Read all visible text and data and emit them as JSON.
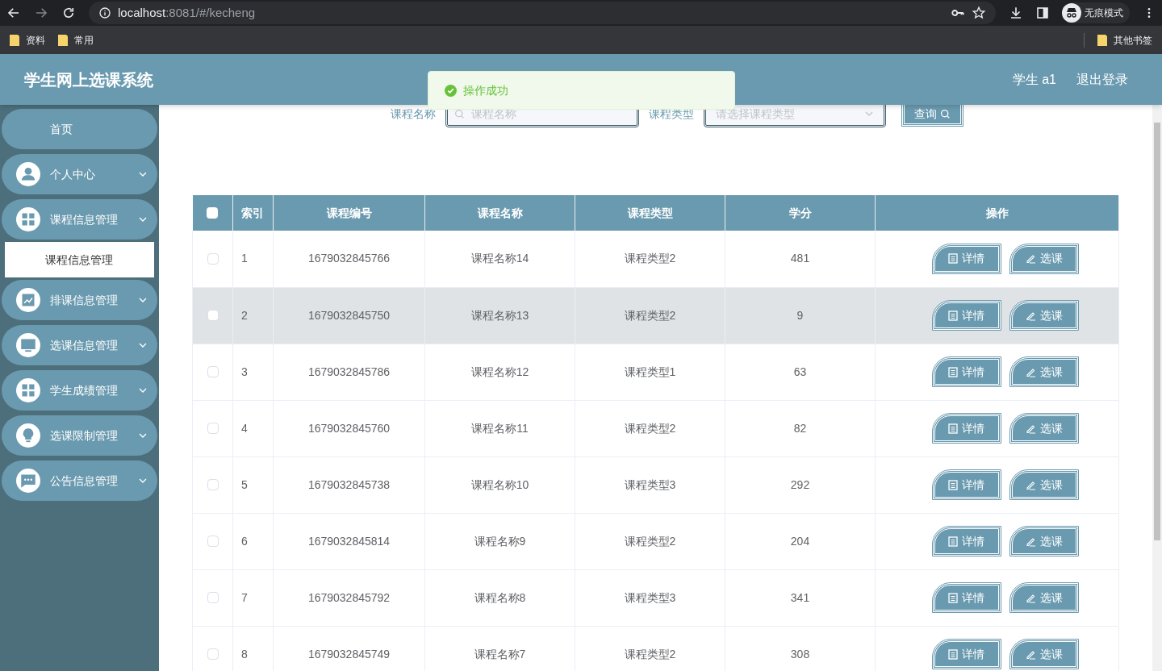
{
  "browser": {
    "url_host": "localhost",
    "url_rest": ":8081/#/kecheng",
    "bookmarks": [
      "资料",
      "常用"
    ],
    "other_bookmarks": "其他书签",
    "profile": "无痕模式"
  },
  "header": {
    "title": "学生网上选课系统",
    "user": "学生 a1",
    "logout": "退出登录"
  },
  "toast": {
    "message": "操作成功"
  },
  "sidebar": {
    "items": [
      {
        "label": "首页",
        "kind": "link"
      },
      {
        "label": "个人中心",
        "kind": "menu"
      },
      {
        "label": "课程信息管理",
        "kind": "menu",
        "children": [
          {
            "label": "课程信息管理",
            "selected": true
          }
        ]
      },
      {
        "label": "排课信息管理",
        "kind": "menu"
      },
      {
        "label": "选课信息管理",
        "kind": "menu"
      },
      {
        "label": "学生成绩管理",
        "kind": "menu"
      },
      {
        "label": "选课限制管理",
        "kind": "menu"
      },
      {
        "label": "公告信息管理",
        "kind": "menu"
      }
    ]
  },
  "search": {
    "name_label": "课程名称",
    "name_placeholder": "课程名称",
    "type_label": "课程类型",
    "type_placeholder": "请选择课程类型",
    "button": "查询"
  },
  "table": {
    "select_all": false,
    "columns": [
      "索引",
      "课程编号",
      "课程名称",
      "课程类型",
      "学分",
      "操作"
    ],
    "rows": [
      {
        "cells": [
          "1",
          "1679032845766",
          "课程名称14",
          "课程类型2",
          "481"
        ],
        "actions": [
          "详情",
          "选课"
        ],
        "checked": false,
        "highlighted": false
      },
      {
        "cells": [
          "2",
          "1679032845750",
          "课程名称13",
          "课程类型2",
          "9"
        ],
        "actions": [
          "详情",
          "选课"
        ],
        "checked": false,
        "highlighted": true
      },
      {
        "cells": [
          "3",
          "1679032845786",
          "课程名称12",
          "课程类型1",
          "63"
        ],
        "actions": [
          "详情",
          "选课"
        ],
        "checked": false,
        "highlighted": false
      },
      {
        "cells": [
          "4",
          "1679032845760",
          "课程名称11",
          "课程类型2",
          "82"
        ],
        "actions": [
          "详情",
          "选课"
        ],
        "checked": false,
        "highlighted": false
      },
      {
        "cells": [
          "5",
          "1679032845738",
          "课程名称10",
          "课程类型3",
          "292"
        ],
        "actions": [
          "详情",
          "选课"
        ],
        "checked": false,
        "highlighted": false
      },
      {
        "cells": [
          "6",
          "1679032845814",
          "课程名称9",
          "课程类型2",
          "204"
        ],
        "actions": [
          "详情",
          "选课"
        ],
        "checked": false,
        "highlighted": false
      },
      {
        "cells": [
          "7",
          "1679032845792",
          "课程名称8",
          "课程类型3",
          "341"
        ],
        "actions": [
          "详情",
          "选课"
        ],
        "checked": false,
        "highlighted": false
      },
      {
        "cells": [
          "8",
          "1679032845749",
          "课程名称7",
          "课程类型2",
          "308"
        ],
        "actions": [
          "详情",
          "选课"
        ],
        "checked": false,
        "highlighted": false
      }
    ]
  }
}
